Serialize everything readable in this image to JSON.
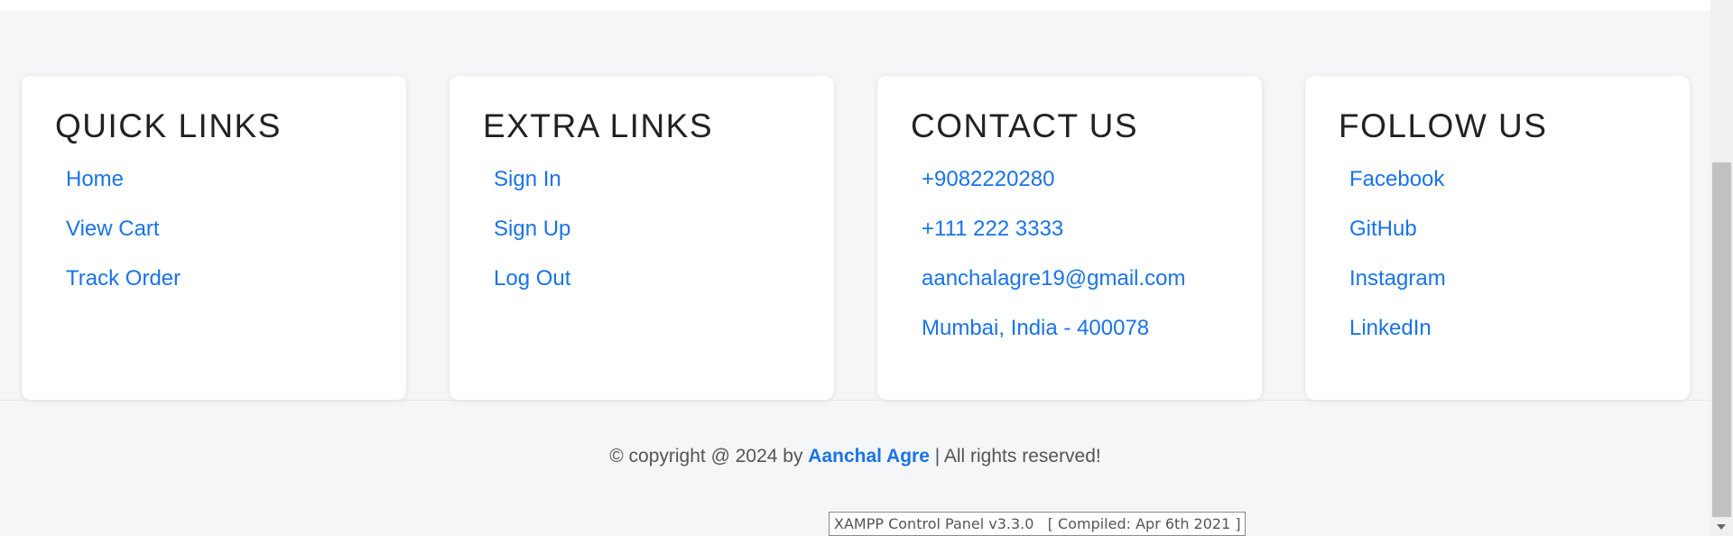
{
  "footer": {
    "sections": [
      {
        "title": "QUICK LINKS",
        "links": [
          "Home",
          "View Cart",
          "Track Order"
        ]
      },
      {
        "title": "EXTRA LINKS",
        "links": [
          "Sign In",
          "Sign Up",
          "Log Out"
        ]
      },
      {
        "title": "CONTACT US",
        "links": [
          "+9082220280",
          "+111 222 3333",
          "aanchalagre19@gmail.com",
          "Mumbai, India - 400078"
        ]
      },
      {
        "title": "FOLLOW US",
        "links": [
          "Facebook",
          "GitHub",
          "Instagram",
          "LinkedIn"
        ]
      }
    ],
    "copyright": {
      "prefix": "© copyright @ 2024 by ",
      "author": "Aanchal Agre",
      "suffix": " | All rights reserved!"
    }
  },
  "tooltip": {
    "text": "XAMPP Control Panel v3.3.0   [ Compiled: Apr 6th 2021 ]"
  },
  "colors": {
    "link": "#1a73e8",
    "background": "#f5f6f7",
    "card": "#ffffff"
  }
}
